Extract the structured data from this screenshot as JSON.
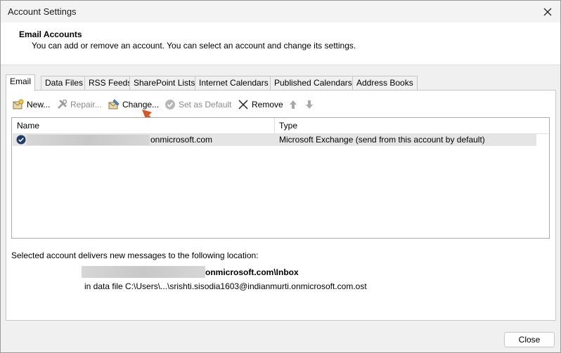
{
  "window": {
    "title": "Account Settings"
  },
  "header": {
    "title": "Email Accounts",
    "subtitle": "You can add or remove an account. You can select an account and change its settings."
  },
  "tabs": [
    {
      "label": "Email",
      "active": true
    },
    {
      "label": "Data Files"
    },
    {
      "label": "RSS Feeds"
    },
    {
      "label": "SharePoint Lists"
    },
    {
      "label": "Internet Calendars"
    },
    {
      "label": "Published Calendars"
    },
    {
      "label": "Address Books"
    }
  ],
  "toolbar": {
    "new": "New...",
    "repair": "Repair...",
    "change": "Change...",
    "set_default": "Set as Default",
    "remove": "Remove"
  },
  "list": {
    "columns": [
      "Name",
      "Type"
    ],
    "rows": [
      {
        "name_suffix": "onmicrosoft.com",
        "type": "Microsoft Exchange (send from this account by default)"
      }
    ]
  },
  "delivery": {
    "label": "Selected account delivers new messages to the following location:",
    "location_suffix": "onmicrosoft.com\\Inbox",
    "data_file": "in data file C:\\Users\\...\\srishti.sisodia1603@indianmurti.onmicrosoft.com.ost"
  },
  "buttons": {
    "close": "Close"
  },
  "colors": {
    "accent_arrow": "#d5572a",
    "selected_row": "#e5e5e5",
    "check_badge": "#1f3c68"
  }
}
